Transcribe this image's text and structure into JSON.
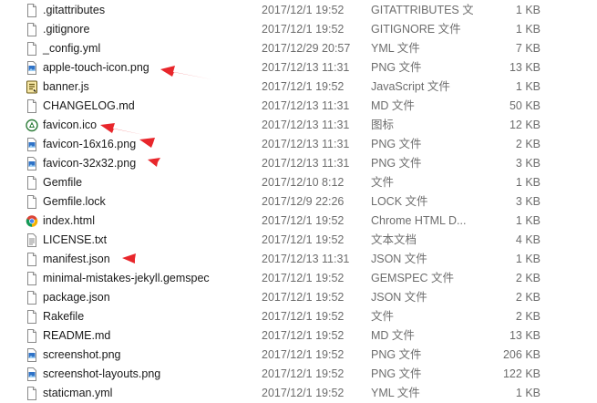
{
  "files": [
    {
      "name": ".gitattributes",
      "date": "2017/12/1 19:52",
      "type": "GITATTRIBUTES 文件",
      "size": "1 KB",
      "icon": "blank-file-icon"
    },
    {
      "name": ".gitignore",
      "date": "2017/12/1 19:52",
      "type": "GITIGNORE 文件",
      "size": "1 KB",
      "icon": "blank-file-icon"
    },
    {
      "name": "_config.yml",
      "date": "2017/12/29 20:57",
      "type": "YML 文件",
      "size": "7 KB",
      "icon": "blank-file-icon"
    },
    {
      "name": "apple-touch-icon.png",
      "date": "2017/12/13 11:31",
      "type": "PNG 文件",
      "size": "13 KB",
      "icon": "image-file-icon"
    },
    {
      "name": "banner.js",
      "date": "2017/12/1 19:52",
      "type": "JavaScript 文件",
      "size": "1 KB",
      "icon": "script-file-icon"
    },
    {
      "name": "CHANGELOG.md",
      "date": "2017/12/13 11:31",
      "type": "MD 文件",
      "size": "50 KB",
      "icon": "blank-file-icon"
    },
    {
      "name": "favicon.ico",
      "date": "2017/12/13 11:31",
      "type": "图标",
      "size": "12 KB",
      "icon": "favicon-icon"
    },
    {
      "name": "favicon-16x16.png",
      "date": "2017/12/13 11:31",
      "type": "PNG 文件",
      "size": "2 KB",
      "icon": "image-file-icon"
    },
    {
      "name": "favicon-32x32.png",
      "date": "2017/12/13 11:31",
      "type": "PNG 文件",
      "size": "3 KB",
      "icon": "image-file-icon"
    },
    {
      "name": "Gemfile",
      "date": "2017/12/10 8:12",
      "type": "文件",
      "size": "1 KB",
      "icon": "blank-file-icon"
    },
    {
      "name": "Gemfile.lock",
      "date": "2017/12/9 22:26",
      "type": "LOCK 文件",
      "size": "3 KB",
      "icon": "blank-file-icon"
    },
    {
      "name": "index.html",
      "date": "2017/12/1 19:52",
      "type": "Chrome HTML D...",
      "size": "1 KB",
      "icon": "chrome-icon"
    },
    {
      "name": "LICENSE.txt",
      "date": "2017/12/1 19:52",
      "type": "文本文档",
      "size": "4 KB",
      "icon": "text-file-icon"
    },
    {
      "name": "manifest.json",
      "date": "2017/12/13 11:31",
      "type": "JSON 文件",
      "size": "1 KB",
      "icon": "blank-file-icon"
    },
    {
      "name": "minimal-mistakes-jekyll.gemspec",
      "date": "2017/12/1 19:52",
      "type": "GEMSPEC 文件",
      "size": "2 KB",
      "icon": "blank-file-icon"
    },
    {
      "name": "package.json",
      "date": "2017/12/1 19:52",
      "type": "JSON 文件",
      "size": "2 KB",
      "icon": "blank-file-icon"
    },
    {
      "name": "Rakefile",
      "date": "2017/12/1 19:52",
      "type": "文件",
      "size": "2 KB",
      "icon": "blank-file-icon"
    },
    {
      "name": "README.md",
      "date": "2017/12/1 19:52",
      "type": "MD 文件",
      "size": "13 KB",
      "icon": "blank-file-icon"
    },
    {
      "name": "screenshot.png",
      "date": "2017/12/1 19:52",
      "type": "PNG 文件",
      "size": "206 KB",
      "icon": "image-file-icon"
    },
    {
      "name": "screenshot-layouts.png",
      "date": "2017/12/1 19:52",
      "type": "PNG 文件",
      "size": "122 KB",
      "icon": "image-file-icon"
    },
    {
      "name": "staticman.yml",
      "date": "2017/12/1 19:52",
      "type": "YML 文件",
      "size": "1 KB",
      "icon": "blank-file-icon"
    }
  ],
  "annotation_color": "#e8262b",
  "annotated_files": [
    "apple-touch-icon.png",
    "favicon.ico",
    "favicon-16x16.png",
    "favicon-32x32.png",
    "manifest.json"
  ]
}
